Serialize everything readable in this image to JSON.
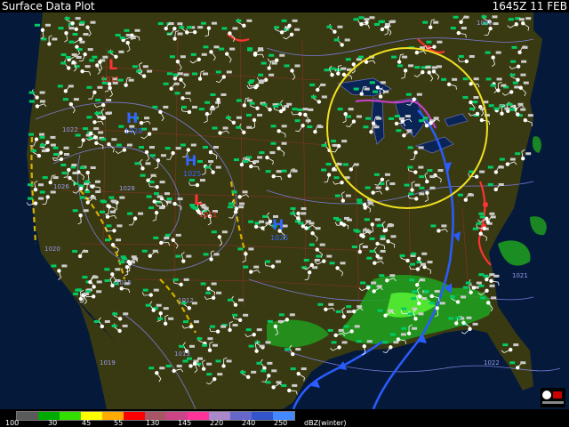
{
  "title": "Surface Data Plot",
  "timestamp": "1645Z 11 FEB",
  "colors": {
    "background": "#051a3a",
    "land": "#3a3a12",
    "cold_front": "#2a5cff",
    "warm_front": "#ff3333",
    "trough": "#d4b000",
    "isobar": "#7a7ad8",
    "highlight_circle": "#f0e020",
    "station_dot": "#ffffff",
    "radar_green": "#22cc22"
  },
  "pressure_centers": [
    {
      "type": "L",
      "label": "1011"
    },
    {
      "type": "H",
      "label": "1028"
    },
    {
      "type": "H",
      "label": "1025"
    },
    {
      "type": "L",
      "label": "1011"
    },
    {
      "type": "H",
      "label": "1025"
    }
  ],
  "isobar_labels": [
    "1008",
    "1022",
    "1026",
    "1028",
    "1020",
    "1015",
    "1012",
    "1019",
    "1013",
    "1021",
    "1022"
  ],
  "legend": {
    "colors": [
      "#5a5a5a",
      "#00aa00",
      "#33dd00",
      "#ffff00",
      "#ffaa00",
      "#ff0000",
      "#aa5566",
      "#cc4488",
      "#ff3399",
      "#aa88cc",
      "#6666cc",
      "#3355cc",
      "#4488ff"
    ],
    "labels": [
      "100",
      "30",
      "45",
      "55",
      "130",
      "145",
      "220",
      "240",
      "250"
    ],
    "units": "dBZ(winter)"
  }
}
